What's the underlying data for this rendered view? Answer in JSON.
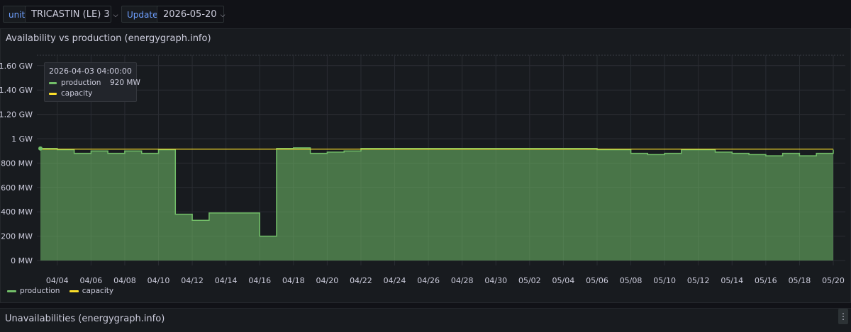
{
  "toolbar": {
    "unit_label": "unit",
    "unit_value": "TRICASTIN (LE) 3",
    "update_label": "Update",
    "date_value": "2026-05-20",
    "chevron_icon": "chevron-down-icon"
  },
  "panel": {
    "title": "Availability vs production (energygraph.info)"
  },
  "panel2": {
    "title": "Unavailabilities (energygraph.info)",
    "menu_icon": "vertical-ellipsis-icon"
  },
  "tooltip": {
    "time": "2026-04-03 04:00:00",
    "rows": [
      {
        "name": "production",
        "value": "920 MW"
      },
      {
        "name": "capacity",
        "value": ""
      }
    ]
  },
  "colors": {
    "production": "#73bf69",
    "capacity": "#fade2a",
    "accent": "#6e9fff"
  },
  "chart_data": {
    "type": "area",
    "title": "Availability vs production (energygraph.info)",
    "x_start": "2026-04-03",
    "x_end": "2026-05-20",
    "x_ticks": [
      "04/04",
      "04/06",
      "04/08",
      "04/10",
      "04/12",
      "04/14",
      "04/16",
      "04/18",
      "04/20",
      "04/22",
      "04/24",
      "04/26",
      "04/28",
      "04/30",
      "05/02",
      "05/04",
      "05/06",
      "05/08",
      "05/10",
      "05/12",
      "05/14",
      "05/16",
      "05/18",
      "05/20"
    ],
    "y_ticks": [
      "0 MW",
      "200 MW",
      "400 MW",
      "600 MW",
      "800 MW",
      "1 GW",
      "1.20 GW",
      "1.40 GW",
      "1.60 GW"
    ],
    "y_tick_values": [
      0,
      200,
      400,
      600,
      800,
      1000,
      1200,
      1400,
      1600
    ],
    "ylim": [
      -40,
      1700
    ],
    "grid": true,
    "legend": "bottom-left",
    "series": [
      {
        "name": "capacity",
        "x": [
          "2026-04-03",
          "2026-05-20"
        ],
        "values": [
          915,
          915
        ]
      },
      {
        "name": "production",
        "x": [
          "2026-04-03",
          "2026-04-04",
          "2026-04-05",
          "2026-04-06",
          "2026-04-07",
          "2026-04-08",
          "2026-04-09",
          "2026-04-10",
          "2026-04-11",
          "2026-04-12",
          "2026-04-13",
          "2026-04-14",
          "2026-04-15",
          "2026-04-16",
          "2026-04-17",
          "2026-04-18",
          "2026-04-19",
          "2026-04-20",
          "2026-04-21",
          "2026-04-22",
          "2026-04-23",
          "2026-04-24",
          "2026-04-25",
          "2026-04-26",
          "2026-04-27",
          "2026-04-28",
          "2026-04-29",
          "2026-04-30",
          "2026-05-01",
          "2026-05-02",
          "2026-05-03",
          "2026-05-04",
          "2026-05-05",
          "2026-05-06",
          "2026-05-07",
          "2026-05-08",
          "2026-05-09",
          "2026-05-10",
          "2026-05-11",
          "2026-05-12",
          "2026-05-13",
          "2026-05-14",
          "2026-05-15",
          "2026-05-16",
          "2026-05-17",
          "2026-05-18",
          "2026-05-19",
          "2026-05-20"
        ],
        "values": [
          920,
          910,
          880,
          900,
          880,
          900,
          880,
          910,
          380,
          330,
          390,
          390,
          390,
          200,
          920,
          925,
          880,
          890,
          900,
          920,
          920,
          920,
          920,
          920,
          920,
          920,
          920,
          920,
          920,
          920,
          920,
          920,
          920,
          910,
          910,
          880,
          870,
          880,
          910,
          910,
          890,
          880,
          870,
          860,
          880,
          860,
          880,
          910
        ]
      }
    ]
  }
}
